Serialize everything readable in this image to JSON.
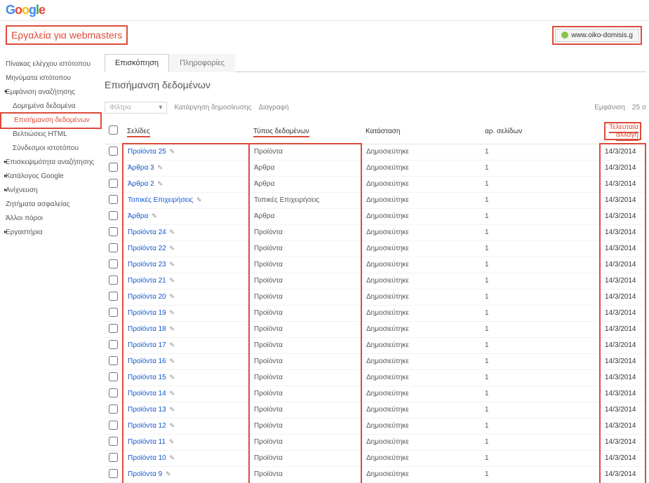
{
  "logo": {
    "g1": "G",
    "o1": "o",
    "o2": "o",
    "g2": "g",
    "l": "l",
    "e": "e"
  },
  "app_title": "Εργαλεία για webmasters",
  "site": "www.oiko-domisis.g",
  "sidebar": {
    "items": [
      {
        "label": "Πίνακας ελέγχου ιστότοπου",
        "kind": "top"
      },
      {
        "label": "Μηνύματα ιστότοπου",
        "kind": "top"
      },
      {
        "label": "Εμφάνιση αναζήτησης",
        "kind": "expanded"
      },
      {
        "label": "Δομημένα δεδομένα",
        "kind": "sub"
      },
      {
        "label": "Επισήμανση δεδομένων",
        "kind": "sub active hl"
      },
      {
        "label": "Βελτιώσεις HTML",
        "kind": "sub"
      },
      {
        "label": "Σύνδεσμοι ιστοτόπου",
        "kind": "sub"
      },
      {
        "label": "Επισκεψιμότητα αναζήτησης",
        "kind": "expandable"
      },
      {
        "label": "Κατάλογος Google",
        "kind": "expandable"
      },
      {
        "label": "Ανίχνευση",
        "kind": "expandable"
      },
      {
        "label": "Ζητήματα ασφαλείας",
        "kind": "top"
      },
      {
        "label": "Άλλοι πόροι",
        "kind": "top"
      },
      {
        "label": "Εργαστήρια",
        "kind": "expandable"
      }
    ]
  },
  "tabs": [
    {
      "label": "Επισκόπηση",
      "active": true
    },
    {
      "label": "Πληροφορίες",
      "active": false
    }
  ],
  "section_title": "Επισήμανση δεδομένων",
  "toolbar": {
    "filter": "Φίλτρο",
    "unpublish": "Κατάργηση δημοσίευσης",
    "delete": "Διαγραφή",
    "display": "Εμφάνιση",
    "count": "25 σ"
  },
  "columns": {
    "cb": "",
    "pages": "Σελίδες",
    "type": "Τύπος δεδομένων",
    "status": "Κατάσταση",
    "num": "αρ. σελίδων",
    "date": "Τελευταία αλλαγή"
  },
  "rows": [
    {
      "page": "Προϊόντα 25",
      "type": "Προϊόντα",
      "status": "Δημοσιεύτηκε",
      "num": "1",
      "date": "14/3/2014",
      "pencil": true
    },
    {
      "page": "Άρθρα 3",
      "type": "Άρθρα",
      "status": "Δημοσιεύτηκε",
      "num": "1",
      "date": "14/3/2014",
      "pencil": true
    },
    {
      "page": "Άρθρα 2",
      "type": "Άρθρα",
      "status": "Δημοσιεύτηκε",
      "num": "1",
      "date": "14/3/2014",
      "pencil": true
    },
    {
      "page": "Τοπικές Επιχειρήσεις",
      "type": "Τοπικές Επιχειρήσεις",
      "status": "Δημοσιεύτηκε",
      "num": "1",
      "date": "14/3/2014",
      "pencil": true
    },
    {
      "page": "Άρθρα",
      "type": "Άρθρα",
      "status": "Δημοσιεύτηκε",
      "num": "1",
      "date": "14/3/2014",
      "pencil": true
    },
    {
      "page": "Προϊόντα 24",
      "type": "Προϊόντα",
      "status": "Δημοσιεύτηκε",
      "num": "1",
      "date": "14/3/2014",
      "pencil": true
    },
    {
      "page": "Προϊόντα 22",
      "type": "Προϊόντα",
      "status": "Δημοσιεύτηκε",
      "num": "1",
      "date": "14/3/2014",
      "pencil": true
    },
    {
      "page": "Προϊόντα 23",
      "type": "Προϊόντα",
      "status": "Δημοσιεύτηκε",
      "num": "1",
      "date": "14/3/2014",
      "pencil": true
    },
    {
      "page": "Προϊόντα 21",
      "type": "Προϊόντα",
      "status": "Δημοσιεύτηκε",
      "num": "1",
      "date": "14/3/2014",
      "pencil": true
    },
    {
      "page": "Προϊόντα 20",
      "type": "Προϊόντα",
      "status": "Δημοσιεύτηκε",
      "num": "1",
      "date": "14/3/2014",
      "pencil": true
    },
    {
      "page": "Προϊόντα 19",
      "type": "Προϊόντα",
      "status": "Δημοσιεύτηκε",
      "num": "1",
      "date": "14/3/2014",
      "pencil": true
    },
    {
      "page": "Προϊόντα 18",
      "type": "Προϊόντα",
      "status": "Δημοσιεύτηκε",
      "num": "1",
      "date": "14/3/2014",
      "pencil": true
    },
    {
      "page": "Προϊόντα 17",
      "type": "Προϊόντα",
      "status": "Δημοσιεύτηκε",
      "num": "1",
      "date": "14/3/2014",
      "pencil": true
    },
    {
      "page": "Προϊόντα 16",
      "type": "Προϊόντα",
      "status": "Δημοσιεύτηκε",
      "num": "1",
      "date": "14/3/2014",
      "pencil": true
    },
    {
      "page": "Προϊόντα 15",
      "type": "Προϊόντα",
      "status": "Δημοσιεύτηκε",
      "num": "1",
      "date": "14/3/2014",
      "pencil": true
    },
    {
      "page": "Προϊόντα 14",
      "type": "Προϊόντα",
      "status": "Δημοσιεύτηκε",
      "num": "1",
      "date": "14/3/2014",
      "pencil": true
    },
    {
      "page": "Προϊόντα 13",
      "type": "Προϊόντα",
      "status": "Δημοσιεύτηκε",
      "num": "1",
      "date": "14/3/2014",
      "pencil": true
    },
    {
      "page": "Προϊόντα 12",
      "type": "Προϊόντα",
      "status": "Δημοσιεύτηκε",
      "num": "1",
      "date": "14/3/2014",
      "pencil": true
    },
    {
      "page": "Προϊόντα 11",
      "type": "Προϊόντα",
      "status": "Δημοσιεύτηκε",
      "num": "1",
      "date": "14/3/2014",
      "pencil": true
    },
    {
      "page": "Προϊόντα 10",
      "type": "Προϊόντα",
      "status": "Δημοσιεύτηκε",
      "num": "1",
      "date": "14/3/2014",
      "pencil": true
    },
    {
      "page": "Προϊόντα 9",
      "type": "Προϊόντα",
      "status": "Δημοσιεύτηκε",
      "num": "1",
      "date": "14/3/2014",
      "pencil": true
    }
  ]
}
